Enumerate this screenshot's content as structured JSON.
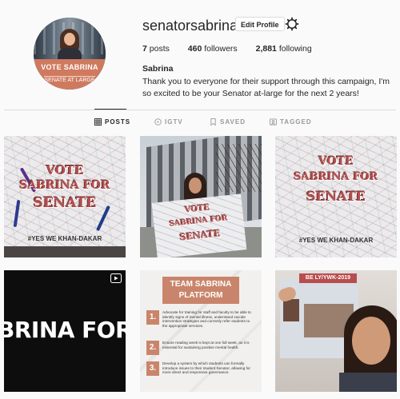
{
  "profile": {
    "username": "senatorsabrina",
    "edit_label": "Edit Profile",
    "avatar_line1": "VOTE SABRINA",
    "avatar_line2": "SENATE AT LARGE",
    "posts_count": "7",
    "posts_label": "posts",
    "followers_count": "460",
    "followers_label": "followers",
    "following_count": "2,881",
    "following_label": "following",
    "full_name": "Sabrina",
    "bio": "Thank you to everyone for their support through this campaign, I'm so excited to be your Senator at-large for the next 2 years!"
  },
  "tabs": [
    {
      "label": "POSTS",
      "icon": "grid-icon",
      "active": true
    },
    {
      "label": "IGTV",
      "icon": "igtv-icon",
      "active": false
    },
    {
      "label": "SAVED",
      "icon": "bookmark-icon",
      "active": false
    },
    {
      "label": "TAGGED",
      "icon": "tagged-icon",
      "active": false
    }
  ],
  "posts": {
    "p1": {
      "l1": "VOTE",
      "l2": "SABRINA FOR",
      "l3": "SENATE",
      "hashtag": "#YES WE KHAN-DAKAR"
    },
    "p2": {
      "l1": "VOTE",
      "l2": "SABRINA FOR",
      "l3": "SENATE"
    },
    "p3": {
      "l1": "VOTE",
      "l2": "SABRINA FOR",
      "l3": "SENATE",
      "hashtag": "#YES WE KHAN-DAKAR"
    },
    "p4": {
      "text": "BRINA FOR SEN"
    },
    "p5": {
      "title": "TEAM SABRINA PLATFORM",
      "items": [
        {
          "n": "1.",
          "t": "Advocate for training for staff and faculty to be able to identify signs of mental illness, understand suicide intervention strategies and correctly refer students to the appropriate services."
        },
        {
          "n": "2.",
          "t": "Ensure reading week is kept at one full week, as it is essential for sustaining positive mental health."
        },
        {
          "n": "3.",
          "t": "Develop a system by which students can formally introduce issues to their student Senator, allowing for more direct and responsive governance."
        }
      ]
    },
    "p6": {
      "tag": "BE LY/YWK-2019"
    }
  },
  "colors": {
    "accent": "#cf7a5f",
    "poster_red": "#b34f4f",
    "border": "#dbdbdb"
  }
}
